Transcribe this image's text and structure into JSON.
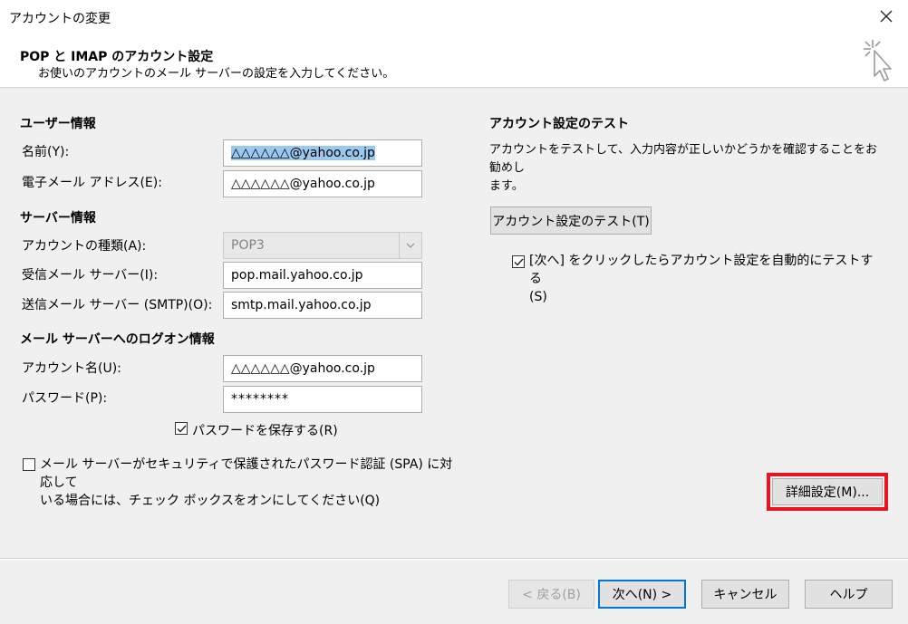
{
  "window": {
    "title": "アカウントの変更"
  },
  "header": {
    "title": "POP と IMAP のアカウント設定",
    "subtitle": "お使いのアカウントのメール サーバーの設定を入力してください。"
  },
  "user_info": {
    "section": "ユーザー情報",
    "name_label": "名前(Y):",
    "name_value": "△△△△△△@yahoo.co.jp",
    "email_label": "電子メール アドレス(E):",
    "email_value": "△△△△△△@yahoo.co.jp"
  },
  "server_info": {
    "section": "サーバー情報",
    "account_type_label": "アカウントの種類(A):",
    "account_type_value": "POP3",
    "incoming_label": "受信メール サーバー(I):",
    "incoming_value": "pop.mail.yahoo.co.jp",
    "outgoing_label": "送信メール サーバー (SMTP)(O):",
    "outgoing_value": "smtp.mail.yahoo.co.jp"
  },
  "logon_info": {
    "section": "メール サーバーへのログオン情報",
    "account_name_label": "アカウント名(U):",
    "account_name_value": "△△△△△△@yahoo.co.jp",
    "password_label": "パスワード(P):",
    "password_value": "********",
    "save_password_label": "パスワードを保存する(R)",
    "save_password_checked": true,
    "spa_label_line1": "メール サーバーがセキュリティで保護されたパスワード認証 (SPA) に対応してい",
    "spa_label_line1_a": "メール サーバーがセキュリティで保護されたパスワード認証 (SPA) に対応して",
    "spa_label_line2": "いる場合には、チェック ボックスをオンにしてください(Q)",
    "spa_checked": false
  },
  "test": {
    "section": "アカウント設定のテスト",
    "description_line1": "アカウントをテストして、入力内容が正しいかどうかを確認することをお勧めし",
    "description_line2": "ます。",
    "test_button": "アカウント設定のテスト(T)",
    "auto_test_line1": "[次へ] をクリックしたらアカウント設定を自動的にテストする",
    "auto_test_line2": "(S)",
    "auto_test_checked": true
  },
  "more_settings_button": "詳細設定(M)...",
  "footer": {
    "back": "< 戻る(B)",
    "next": "次へ(N) >",
    "cancel": "キャンセル",
    "help": "ヘルプ"
  }
}
